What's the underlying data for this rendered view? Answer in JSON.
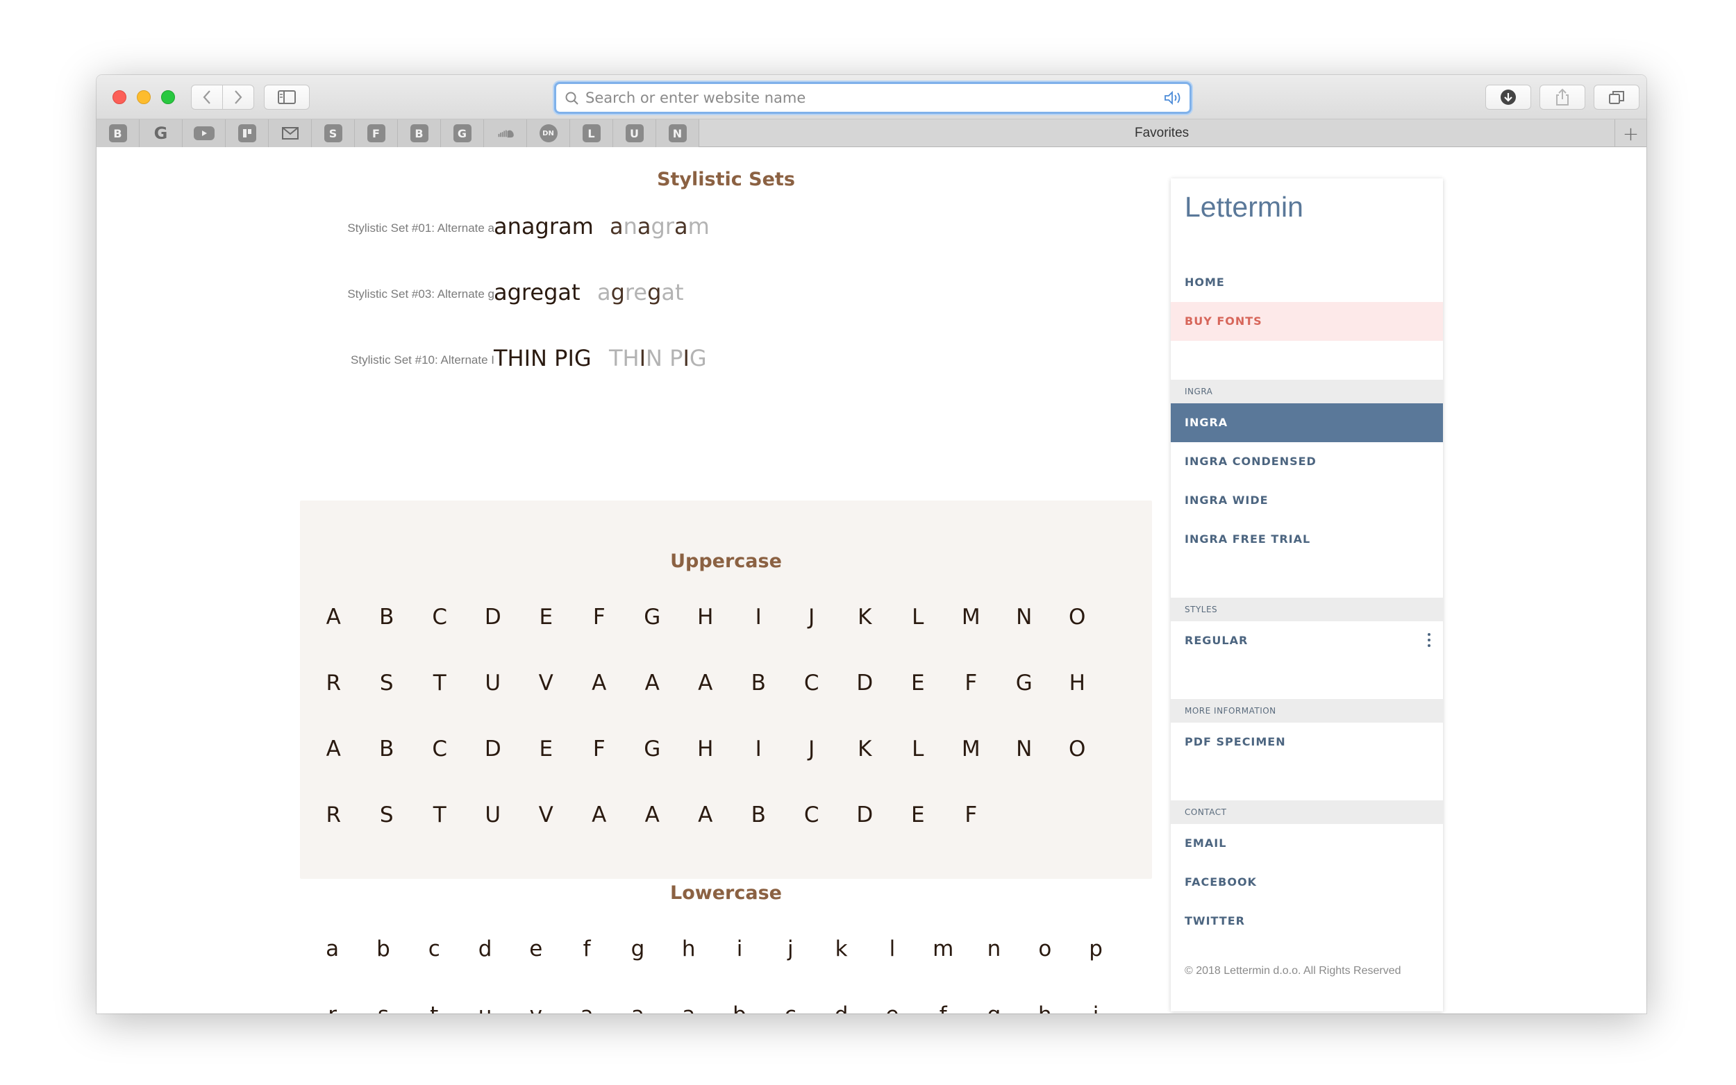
{
  "browser": {
    "url_placeholder": "Search or enter website name",
    "favorites_label": "Favorites",
    "favorites": [
      "B",
      "G",
      "",
      "",
      "",
      "S",
      "F",
      "B",
      "G",
      "",
      "DN",
      "L",
      "U",
      "N"
    ],
    "add_tab_label": "+"
  },
  "page": {
    "stylistic_title": "Stylistic Sets",
    "stylistic_sets": [
      {
        "label": "Stylistic Set #01: Alternate a",
        "sample": "anagram",
        "alt_parts": [
          "a",
          "n",
          "a",
          "g",
          "r",
          "a",
          "m"
        ]
      },
      {
        "label": "Stylistic Set #03: Alternate g",
        "sample": "agregat",
        "alt_parts": [
          "a",
          "g",
          "r",
          "e",
          "g",
          "a",
          "t"
        ]
      },
      {
        "label": "Stylistic Set #10: Alternate I",
        "sample": "THIN PIG",
        "alt_parts": [
          "T",
          "H",
          "I",
          "N",
          " ",
          "P",
          "I",
          "G"
        ]
      }
    ],
    "uppercase_title": "Uppercase",
    "uppercase": [
      "A",
      "B",
      "C",
      "D",
      "E",
      "F",
      "G",
      "H",
      "I",
      "J",
      "K",
      "L",
      "M",
      "N",
      "O",
      "R",
      "S",
      "T",
      "U",
      "V",
      "A",
      "A",
      "A",
      "B",
      "C",
      "D",
      "E",
      "F",
      "G",
      "H",
      "A",
      "B",
      "C",
      "D",
      "E",
      "F",
      "G",
      "H",
      "I",
      "J",
      "K",
      "L",
      "M",
      "N",
      "O",
      "R",
      "S",
      "T",
      "U",
      "V",
      "A",
      "A",
      "A",
      "B",
      "C",
      "D",
      "E",
      "F"
    ],
    "lowercase_title": "Lowercase",
    "lowercase": [
      "a",
      "b",
      "c",
      "d",
      "e",
      "f",
      "g",
      "h",
      "i",
      "j",
      "k",
      "l",
      "m",
      "n",
      "o",
      "p",
      "r",
      "s",
      "t",
      "u",
      "v",
      "a",
      "a",
      "a",
      "b",
      "c",
      "d",
      "e",
      "f",
      "g",
      "h",
      "i"
    ]
  },
  "sidebar": {
    "brand": "Lettermin",
    "home": "HOME",
    "buy_fonts": "BUY FONTS",
    "ingra_head": "INGRA",
    "ingra_items": [
      "INGRA",
      "INGRA CONDENSED",
      "INGRA WIDE",
      "INGRA FREE TRIAL"
    ],
    "styles_head": "STYLES",
    "styles_item": "REGULAR",
    "more_head": "MORE INFORMATION",
    "pdf": "PDF SPECIMEN",
    "contact_head": "CONTACT",
    "contact_items": [
      "EMAIL",
      "FACEBOOK",
      "TWITTER"
    ],
    "copyright": "© 2018 Lettermin d.o.o. All Rights Reserved"
  },
  "colors": {
    "accent": "#5a7899",
    "heading": "#8b6142",
    "buy_bg": "#fde9e9",
    "buy_text": "#d7665a"
  }
}
